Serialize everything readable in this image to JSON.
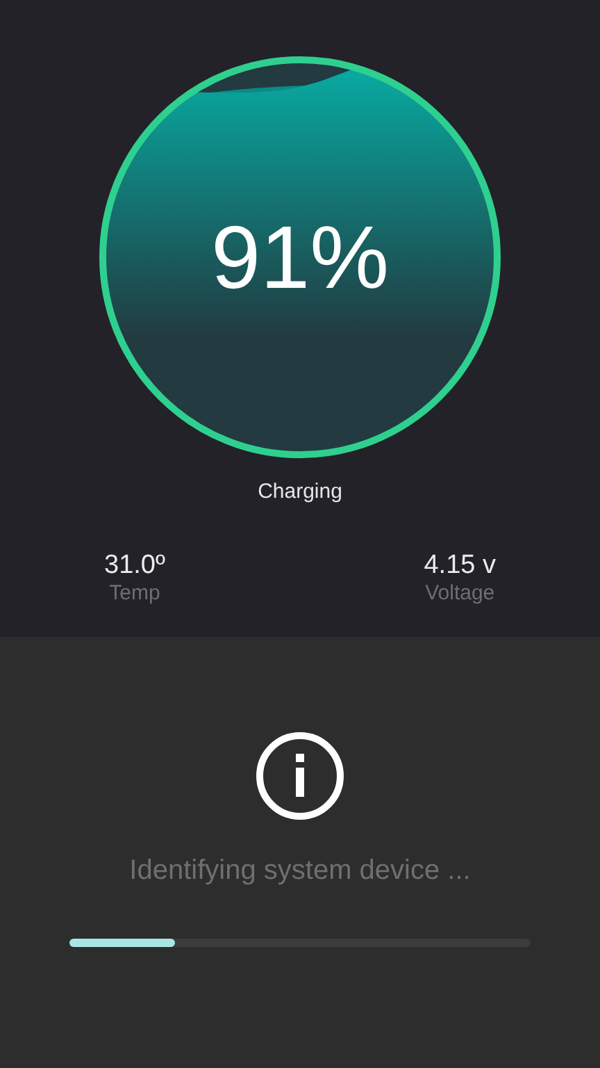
{
  "gauge": {
    "percent": "91%",
    "status": "Charging"
  },
  "stats": [
    {
      "value": "31.0º",
      "label": "Temp"
    },
    {
      "value": "4.15 v",
      "label": "Voltage"
    }
  ],
  "task": {
    "message": "Identifying system device ...",
    "level": 0.23
  }
}
